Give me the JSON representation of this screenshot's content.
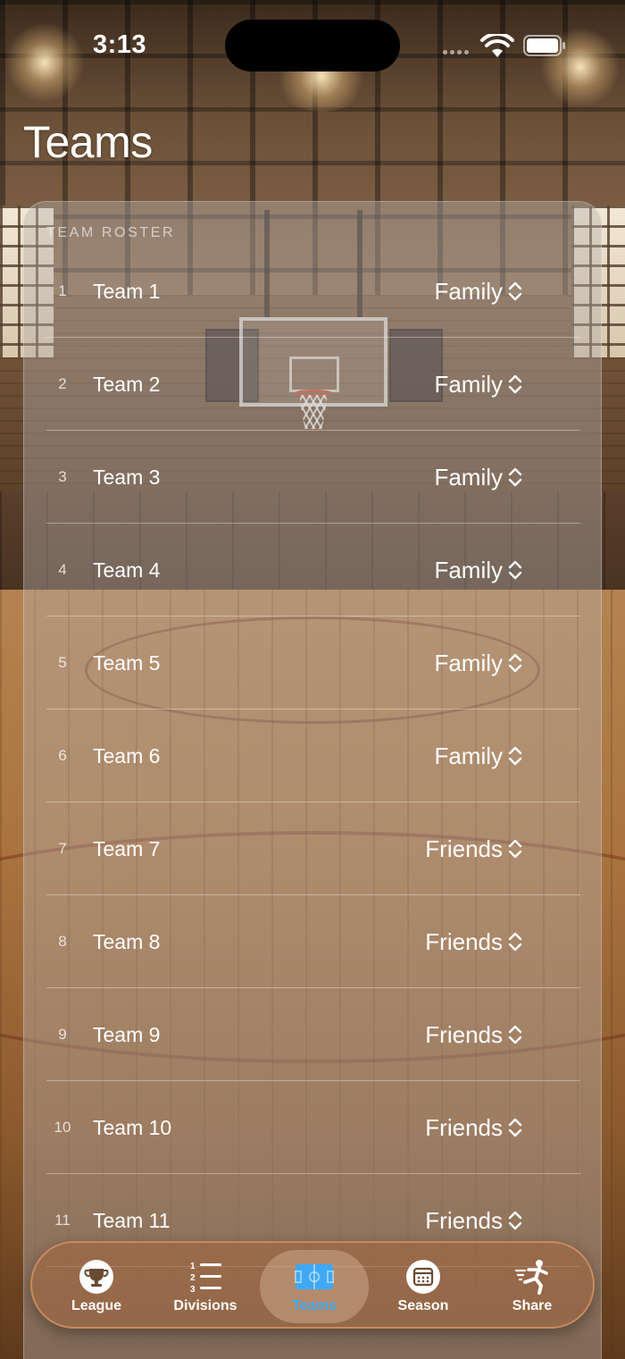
{
  "status_bar": {
    "time": "3:13"
  },
  "header": {
    "title": "Teams"
  },
  "roster": {
    "section_title": "TEAM ROSTER",
    "teams": [
      {
        "number": "1",
        "name": "Team 1",
        "group": "Family"
      },
      {
        "number": "2",
        "name": "Team 2",
        "group": "Family"
      },
      {
        "number": "3",
        "name": "Team 3",
        "group": "Family"
      },
      {
        "number": "4",
        "name": "Team 4",
        "group": "Family"
      },
      {
        "number": "5",
        "name": "Team 5",
        "group": "Family"
      },
      {
        "number": "6",
        "name": "Team 6",
        "group": "Family"
      },
      {
        "number": "7",
        "name": "Team 7",
        "group": "Friends"
      },
      {
        "number": "8",
        "name": "Team 8",
        "group": "Friends"
      },
      {
        "number": "9",
        "name": "Team 9",
        "group": "Friends"
      },
      {
        "number": "10",
        "name": "Team 10",
        "group": "Friends"
      },
      {
        "number": "11",
        "name": "Team 11",
        "group": "Friends"
      }
    ]
  },
  "tab_bar": {
    "active_color": "#3fa9f5",
    "tabs": [
      {
        "label": "League",
        "icon": "trophy-icon"
      },
      {
        "label": "Divisions",
        "icon": "numbered-list-icon"
      },
      {
        "label": "Teams",
        "icon": "court-icon",
        "active": true
      },
      {
        "label": "Season",
        "icon": "calendar-icon"
      },
      {
        "label": "Share",
        "icon": "kick-icon"
      }
    ]
  }
}
